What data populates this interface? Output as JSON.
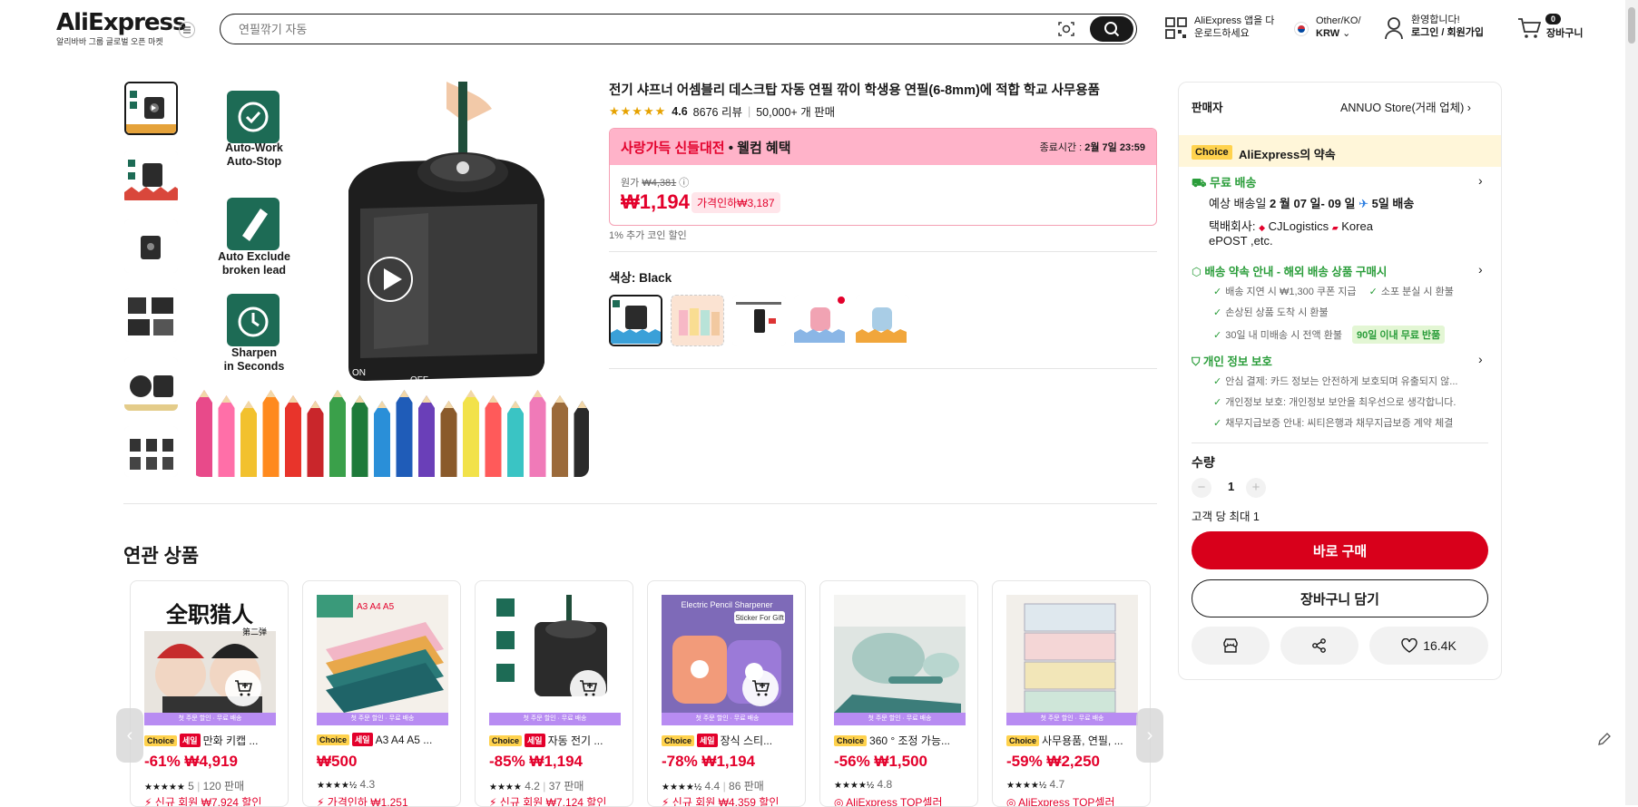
{
  "header": {
    "logo": "AliExpress",
    "logo_sub": "알리바바 그룹 글로벌 오픈 마켓",
    "search_placeholder": "연필깎기 자동",
    "app_line1": "AliExpress 앱을 다",
    "app_line2": "운로드하세요",
    "lang_line1": "Other/KO/",
    "lang_line2": "KRW",
    "user_line1": "환영합니다!",
    "user_line2": "로그인 / 회원가입",
    "cart_count": "0",
    "cart_label": "장바구니"
  },
  "product": {
    "title": "전기 샤프너 어셈블리 데스크탑 자동 연필 깎이 학생용 연필(6-8mm)에 적합 학교 사무용품",
    "rating": "4.6",
    "reviews": "8676 리뷰",
    "sold": "50,000+ 개 판매",
    "promo_title": "사랑가득 신들대전",
    "promo_sub": "• 웰컴 혜택",
    "end_label": "종료시간 :",
    "end_time": "2월 7일 23:59",
    "orig_label": "원가",
    "orig_price": "₩4,381",
    "price": "₩1,194",
    "discount": "가격인하₩3,187",
    "coin": "1% 추가 코인 할인",
    "color_label": "색상: Black",
    "features": [
      "Auto-Work\nAuto-Stop",
      "Auto Exclude\nbroken lead",
      "Sharpen\nin Seconds"
    ],
    "switch_on": "ON",
    "switch_off": "OFF"
  },
  "panel": {
    "seller_label": "판매자",
    "seller_name": "ANNUO Store(거래 업체)",
    "choice_tag": "Choice",
    "promise": "AliExpress의 약속",
    "free_ship": "무료 배송",
    "est_pre": "예상 배송일",
    "est_dates": "2 월 07 일- 09 일",
    "est_days": "5일 배송",
    "carrier_label": "택배회사:",
    "carrier1": "CJLogistics",
    "carrier2": "Korea",
    "carrier3": "ePOST ,etc.",
    "guarantee": "배송 약속 안내 - 해외 배송 상품 구매시",
    "g1": "배송 지연 시 ₩1,300 쿠폰 지급",
    "g2": "소포 분실 시 환불",
    "g3": "손상된 상품 도착 시 환불",
    "g4": "30일 내 미배송 시 전액 환불",
    "g5": "90일 이내 무료 반품",
    "privacy": "개인 정보 보호",
    "p1": "안심 결제: 카드 정보는 안전하게 보호되며 유출되지 않...",
    "p2": "개인정보 보호: 개인정보 보안을 최우선으로 생각합니다.",
    "p3": "채무지급보증 안내: 씨티은행과 채무지급보증 계약 체결",
    "qty_label": "수량",
    "qty": "1",
    "max_label": "고객 당 최대 1",
    "buy": "바로 구매",
    "add_cart": "장바구니 담기",
    "likes": "16.4K"
  },
  "related": {
    "title": "연관 상품",
    "banner": "첫 주문 할인 · 무료 배송",
    "choice": "Choice",
    "sale": "세일",
    "items": [
      {
        "name": "만화 키캡 ...",
        "price": "-61% ₩4,919",
        "stars": "★★★★★",
        "rating": "5",
        "sold": "120 판매",
        "promo": "신규 회원 ₩7,924 할인",
        "sale": true
      },
      {
        "name": "A3 A4 A5 ...",
        "price": "₩500",
        "stars": "★★★★½",
        "rating": "4.3",
        "sold": "",
        "promo": "가격인하 ₩1,251",
        "sale": true
      },
      {
        "name": "자동 전기 ...",
        "price": "-85% ₩1,194",
        "stars": "★★★★",
        "rating": "4.2",
        "sold": "37 판매",
        "promo": "신규 회원 ₩7,124 할인",
        "sale": true
      },
      {
        "name": "장식 스티...",
        "price": "-78% ₩1,194",
        "stars": "★★★★½",
        "rating": "4.4",
        "sold": "86 판매",
        "promo": "신규 회원 ₩4,359 할인",
        "sale": true
      },
      {
        "name": "360 ° 조정 가능...",
        "price": "-56% ₩1,500",
        "stars": "★★★★½",
        "rating": "4.8",
        "sold": "",
        "promo": "AliExpress TOP셀러",
        "sale": false
      },
      {
        "name": "사무용품, 연필, ...",
        "price": "-59% ₩2,250",
        "stars": "★★★★½",
        "rating": "4.7",
        "sold": "",
        "promo": "AliExpress TOP셀러",
        "sale": false
      }
    ]
  },
  "img_text": {
    "a3": "A3 A4 A5",
    "eps": "Electric Pencil Sharpener",
    "sticker": "Sticker For Gift",
    "card0_text": "全职猎人",
    "card0_sub": "第二弹"
  },
  "colors": {
    "accent": "#e3002b",
    "buy": "#d8001b",
    "promo_bg": "#ffb3c9",
    "green": "#2a9d3a",
    "choice": "#ffd24d"
  }
}
